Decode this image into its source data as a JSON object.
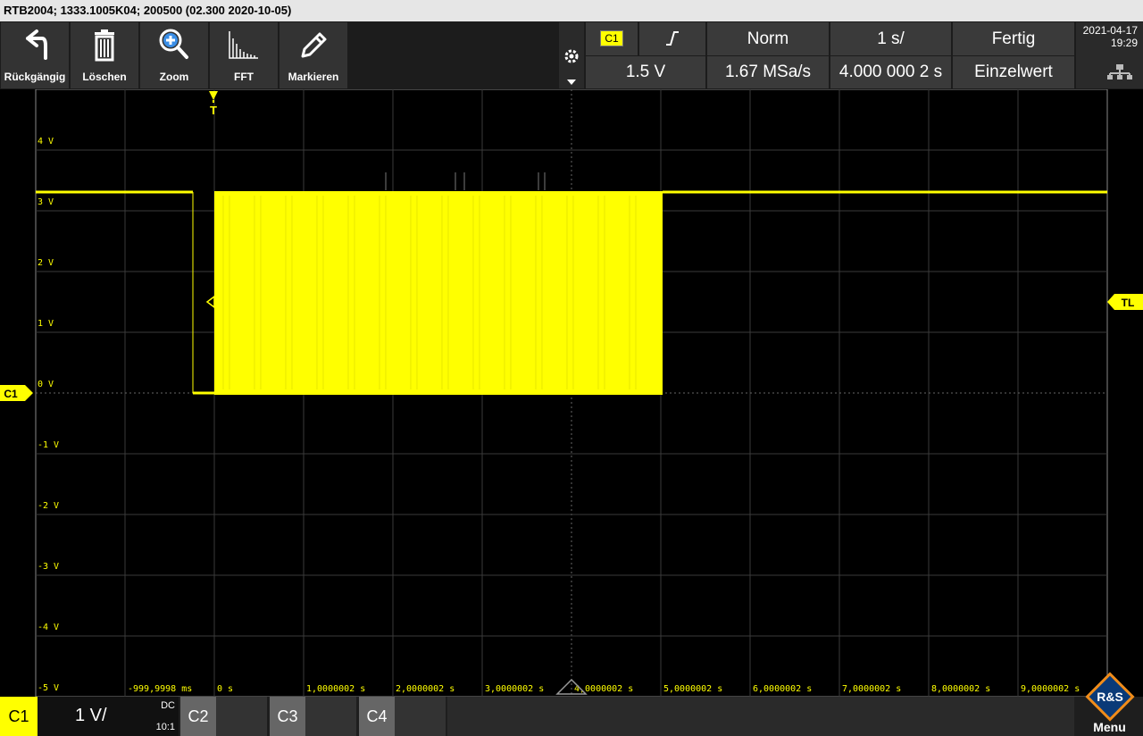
{
  "titlebar": {
    "text": "RTB2004; 1333.1005K04; 200500 (02.300 2020-10-05)"
  },
  "toolbar": {
    "buttons": [
      {
        "label": "Rückgängig",
        "icon": "undo-icon"
      },
      {
        "label": "Löschen",
        "icon": "trash-icon"
      },
      {
        "label": "Zoom",
        "icon": "zoom-in-icon"
      },
      {
        "label": "FFT",
        "icon": "fft-icon"
      },
      {
        "label": "Markieren",
        "icon": "pencil-icon"
      }
    ],
    "gear_icon": "gear-icon",
    "dropdown_icon": "caret-down-icon"
  },
  "trigger_panel": {
    "source": "C1",
    "slope_icon": "rising-edge-icon",
    "mode": "Norm",
    "timebase": "1 s/",
    "status": "Fertig",
    "level": "1.5 V",
    "sample_rate": "1.67 MSa/s",
    "record_length": "4.000 000 2 s",
    "acquisition": "Einzelwert"
  },
  "datetime": {
    "date": "2021-04-17",
    "time": "19:29"
  },
  "network_icon": "network-icon",
  "plot": {
    "trigger_marker": "T",
    "trigger_level_marker": "TL",
    "channel_marker": "C1",
    "y_labels": [
      "4 V",
      "3 V",
      "2 V",
      "1 V",
      "0 V",
      "-1 V",
      "-2 V",
      "-3 V",
      "-4 V",
      "-5 V"
    ],
    "x_labels": [
      "-999,9998 ms",
      "0 s",
      "1,0000002 s",
      "2,0000002 s",
      "3,0000002 s",
      "4,0000002 s",
      "5,0000002 s",
      "6,0000002 s",
      "7,0000002 s",
      "8,0000002 s",
      "9,0000002 s"
    ],
    "trace_color": "#ffff00",
    "grid_color": "#3a3a3a"
  },
  "bottom": {
    "ch1_label": "C1",
    "ch1_scale": "1 V/",
    "ch1_coupling": "DC",
    "ch1_probe": "10:1",
    "ch2_label": "C2",
    "ch3_label": "C3",
    "ch4_label": "C4",
    "menu_label": "Menu",
    "logo_text": "R&S"
  }
}
